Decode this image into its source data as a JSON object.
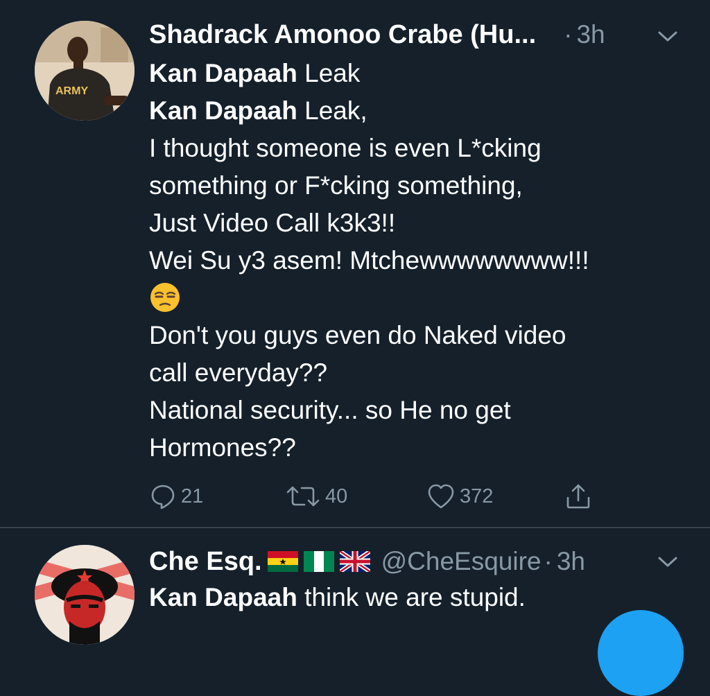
{
  "tweets": [
    {
      "author": "Shadrack Amonoo Crabe (Hu...",
      "dot": "·",
      "time": "3h",
      "avatar_shirt_text": "ARMY",
      "lines": [
        {
          "bold": "Kan Dapaah",
          "text": " Leak"
        },
        {
          "bold": "Kan Dapaah",
          "text": " Leak,"
        },
        {
          "text": "I thought someone is even L*cking"
        },
        {
          "text": "something or F*cking something,"
        },
        {
          "text": "Just Video Call k3k3!!"
        },
        {
          "text": "Wei Su y3 asem! Mtchewwwwwwww!!!"
        },
        {
          "emoji": "unamused-face"
        },
        {
          "text": "Don't you guys even do Naked video"
        },
        {
          "text": "call everyday??"
        },
        {
          "text": "National security... so He no get"
        },
        {
          "text": "Hormones??"
        }
      ],
      "actions": {
        "replies": "21",
        "retweets": "40",
        "likes": "372"
      }
    },
    {
      "author": "Che Esq.",
      "flags": [
        "ghana-flag",
        "nigeria-flag",
        "uk-flag"
      ],
      "handle": "@CheEsquire",
      "dot": "·",
      "time": "3h",
      "bold": "Kan Dapaah",
      "text": " think we are stupid."
    }
  ],
  "colors": {
    "background": "#15202b",
    "divider": "#38444d",
    "secondary_text": "#8899a6",
    "accent": "#1da1f2"
  },
  "icons": [
    "reply-icon",
    "retweet-icon",
    "like-icon",
    "share-icon",
    "chevron-down-icon",
    "compose-fab"
  ]
}
